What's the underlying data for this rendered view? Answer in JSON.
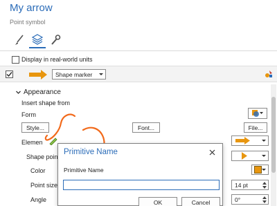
{
  "header": {
    "title": "My arrow",
    "subtitle": "Point symbol"
  },
  "tabs": [
    {
      "icon": "paintbrush-icon",
      "active": false
    },
    {
      "icon": "layers-icon",
      "active": true
    },
    {
      "icon": "wrench-icon",
      "active": false
    }
  ],
  "options": {
    "realworld_label": "Display in real-world units",
    "realworld_checked": false
  },
  "marker": {
    "checked": true,
    "type_value": "Shape marker",
    "arrow_color": "#e8960f"
  },
  "appearance": {
    "section_label": "Appearance",
    "insert_shape_label": "Insert shape from",
    "form_label": "Form",
    "style_button": "Style...",
    "font_button": "Font...",
    "file_button": "File...",
    "element_label": "Elemen",
    "shape_point_label": "Shape poin",
    "color_label": "Color",
    "point_size_label": "Point size",
    "point_size_value": "14 pt",
    "angle_label": "Angle",
    "angle_value": "0°",
    "color_value": "#e8960f"
  },
  "dialog": {
    "title": "Primitive Name",
    "field_label": "Primitive Name",
    "field_value": "",
    "ok_button": "OK",
    "cancel_button": "Cancel"
  },
  "colors": {
    "accent": "#2b6cb8",
    "annotation": "#f26a1b"
  }
}
